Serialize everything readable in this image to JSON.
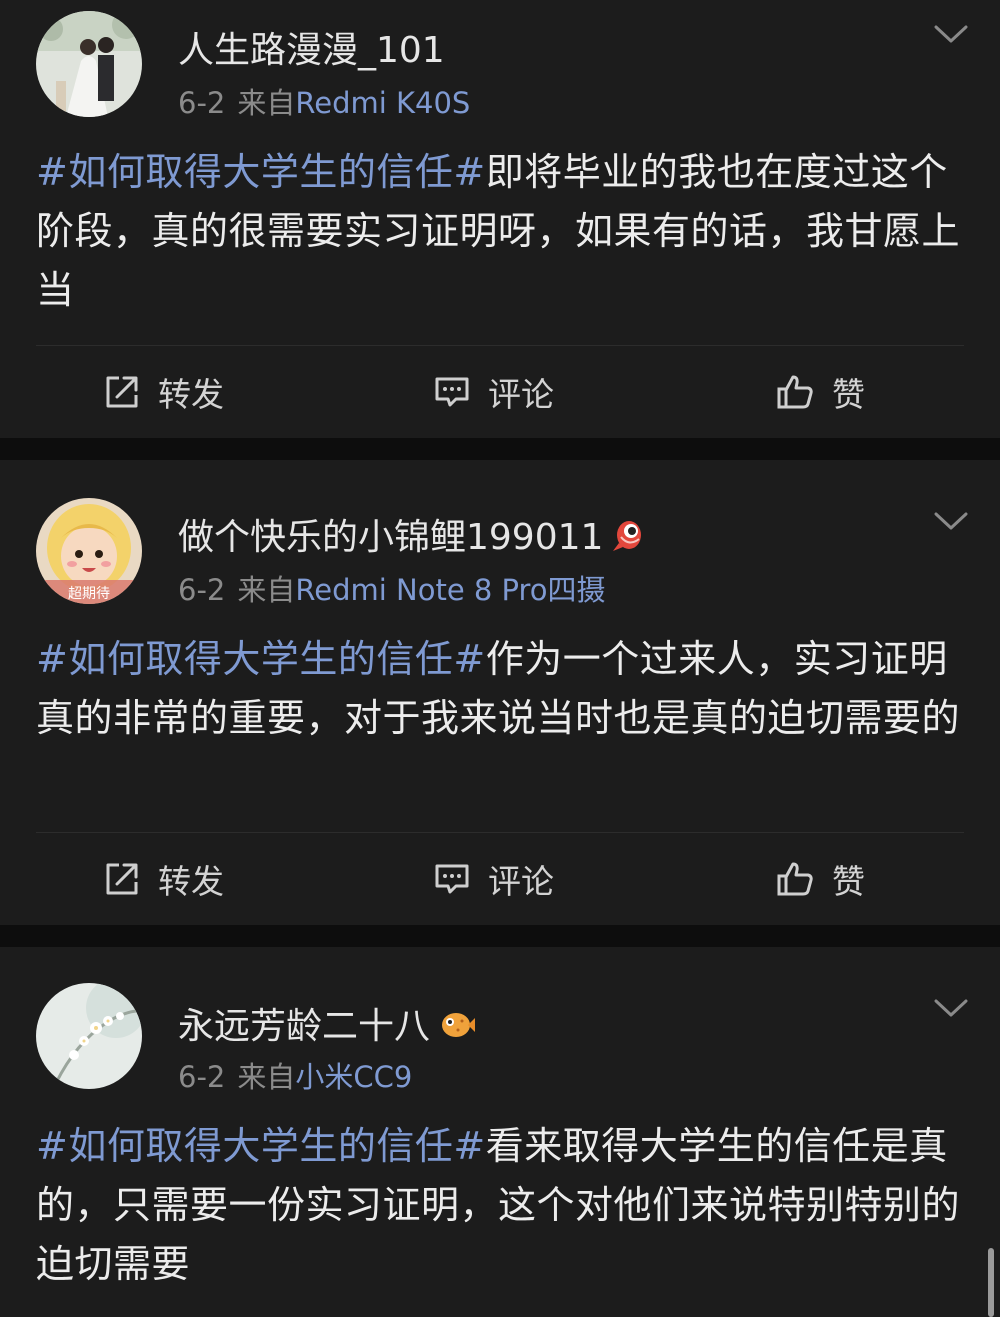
{
  "posts": [
    {
      "username": "人生路漫漫_101",
      "date": "6-2",
      "source_prefix": "来自",
      "device": "Redmi K40S",
      "topic": "#如何取得大学生的信任#",
      "text": "即将毕业的我也在度过这个阶段，真的很需要实习证明呀，如果有的话，我甘愿上当",
      "avatar_icon": "wedding-photo-avatar",
      "badge_icon": null
    },
    {
      "username": "做个快乐的小锦鲤199011",
      "date": "6-2",
      "source_prefix": "来自",
      "device": "Redmi Note 8 Pro四摄",
      "topic": "#如何取得大学生的信任#",
      "text": "作为一个过来人，实习证明真的非常的重要，对于我来说当时也是真的迫切需要的",
      "avatar_icon": "cartoon-girl-avatar",
      "avatar_caption": "超期待",
      "badge_icon": "koi-fish-badge-icon"
    },
    {
      "username": "永远芳龄二十八",
      "date": "6-2",
      "source_prefix": "来自",
      "device": "小米CC9",
      "topic": "#如何取得大学生的信任#",
      "text": "看来取得大学生的信任是真的，只需要一份实习证明，这个对他们来说特别特别的迫切需要",
      "avatar_icon": "flower-photo-avatar",
      "badge_icon": "pufferfish-badge-icon"
    }
  ],
  "actions": {
    "repost_label": "转发",
    "comment_label": "评论",
    "like_label": "赞"
  },
  "colors": {
    "background": "#0d0d0d",
    "card": "#1c1c1c",
    "link_blue": "#7f9ad2",
    "meta_gray": "#8b8b8b"
  }
}
